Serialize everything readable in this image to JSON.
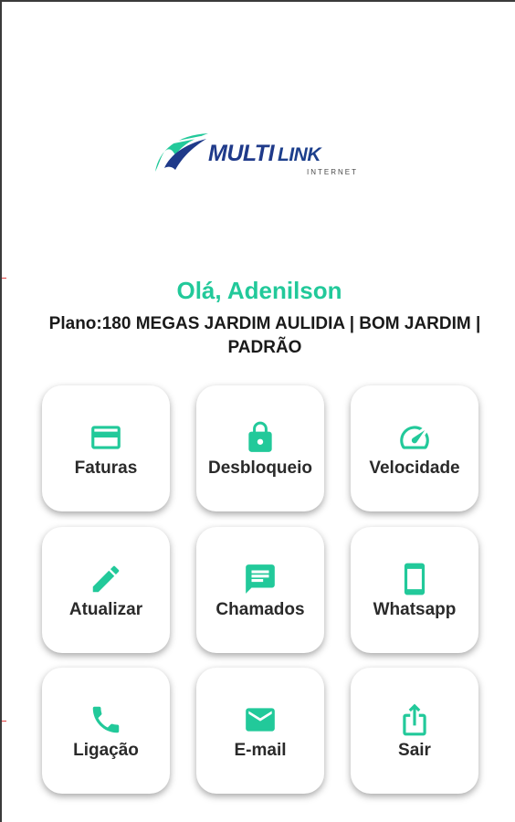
{
  "brand": {
    "name_part1": "MULTI",
    "name_part2": "LINK",
    "subtitle": "INTERNET"
  },
  "greeting": "Olá, Adenilson",
  "plan": "Plano:180 MEGAS JARDIM AULIDIA | BOM JARDIM | PADRÃO",
  "colors": {
    "accent": "#22c99a",
    "brand_blue": "#1f3a8a"
  },
  "menu": [
    {
      "label": "Faturas",
      "icon": "credit-card-icon"
    },
    {
      "label": "Desbloqueio",
      "icon": "lock-icon"
    },
    {
      "label": "Velocidade",
      "icon": "speedometer-icon"
    },
    {
      "label": "Atualizar",
      "icon": "pencil-icon"
    },
    {
      "label": "Chamados",
      "icon": "chat-icon"
    },
    {
      "label": "Whatsapp",
      "icon": "smartphone-icon"
    },
    {
      "label": "Ligação",
      "icon": "phone-icon"
    },
    {
      "label": "E-mail",
      "icon": "mail-icon"
    },
    {
      "label": "Sair",
      "icon": "share-icon"
    }
  ]
}
